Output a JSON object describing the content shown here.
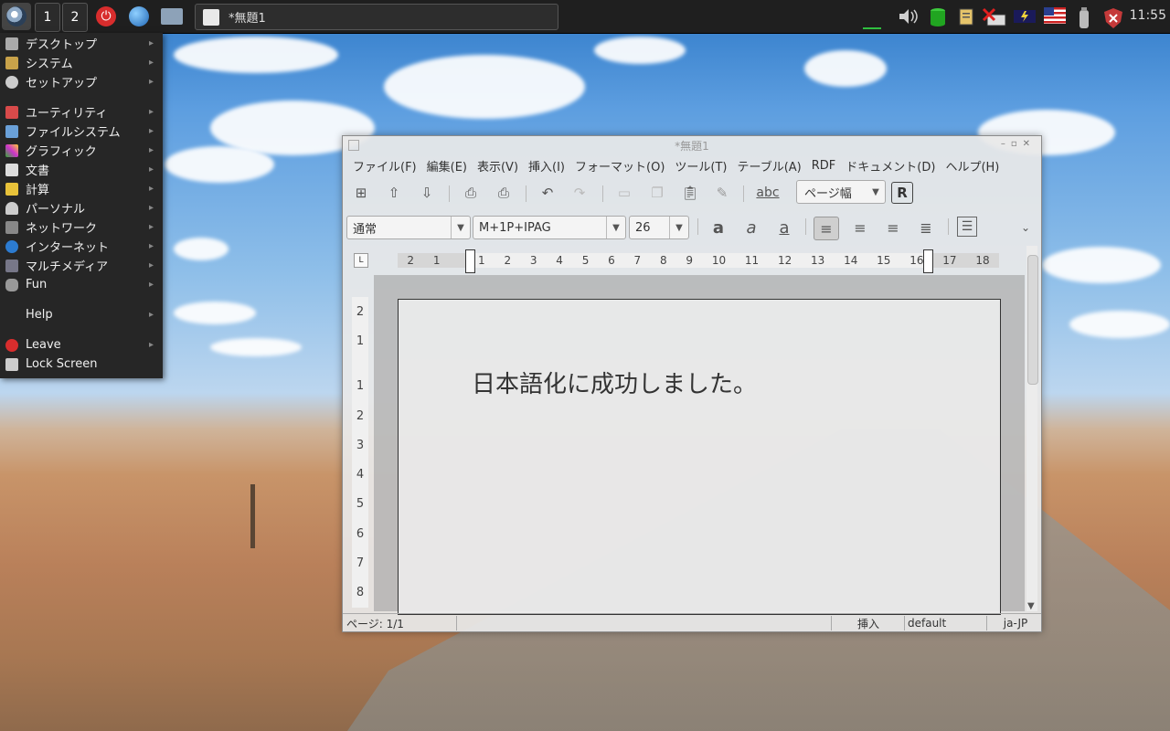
{
  "taskbar": {
    "workspaces": [
      "1",
      "2"
    ],
    "task_title": "*無題1",
    "clock": "11:55"
  },
  "start_menu": {
    "items": [
      {
        "label": "デスクトップ",
        "icon": "desktop-icon"
      },
      {
        "label": "システム",
        "icon": "system-icon"
      },
      {
        "label": "セットアップ",
        "icon": "gear-icon"
      },
      {
        "label": "ユーティリティ",
        "icon": "utility-icon"
      },
      {
        "label": "ファイルシステム",
        "icon": "folder-icon"
      },
      {
        "label": "グラフィック",
        "icon": "graphics-icon"
      },
      {
        "label": "文書",
        "icon": "document-icon"
      },
      {
        "label": "計算",
        "icon": "calculator-icon"
      },
      {
        "label": "パーソナル",
        "icon": "person-icon"
      },
      {
        "label": "ネットワーク",
        "icon": "network-icon"
      },
      {
        "label": "インターネット",
        "icon": "globe-icon"
      },
      {
        "label": "マルチメディア",
        "icon": "multimedia-icon"
      },
      {
        "label": "Fun",
        "icon": "gamepad-icon"
      }
    ],
    "help": "Help",
    "leave": "Leave",
    "lock": "Lock Screen"
  },
  "writer": {
    "title": "*無題1",
    "menus": [
      "ファイル(F)",
      "編集(E)",
      "表示(V)",
      "挿入(I)",
      "フォーマット(O)",
      "ツール(T)",
      "テーブル(A)",
      "RDF",
      "ドキュメント(D)",
      "ヘルプ(H)"
    ],
    "spell_label": "abc",
    "zoom": "ページ幅",
    "style": "通常",
    "font": "M+1P+IPAG",
    "size": "26",
    "ruler_numbers": [
      "2",
      "1",
      "",
      "1",
      "2",
      "3",
      "4",
      "5",
      "6",
      "7",
      "8",
      "9",
      "10",
      "11",
      "12",
      "13",
      "14",
      "15",
      "16",
      "17",
      "18"
    ],
    "vruler_numbers": [
      "2",
      "1",
      "",
      "1",
      "2",
      "3",
      "4",
      "5",
      "6",
      "7",
      "8"
    ],
    "document_text": "日本語化に成功しました。",
    "status": {
      "page": "ページ: 1/1",
      "mode": "挿入",
      "style": "default",
      "lang": "ja-JP"
    }
  },
  "colors": {
    "taskbar": "#1f1f1f",
    "menu": "#262626",
    "power": "#d82d2d"
  }
}
